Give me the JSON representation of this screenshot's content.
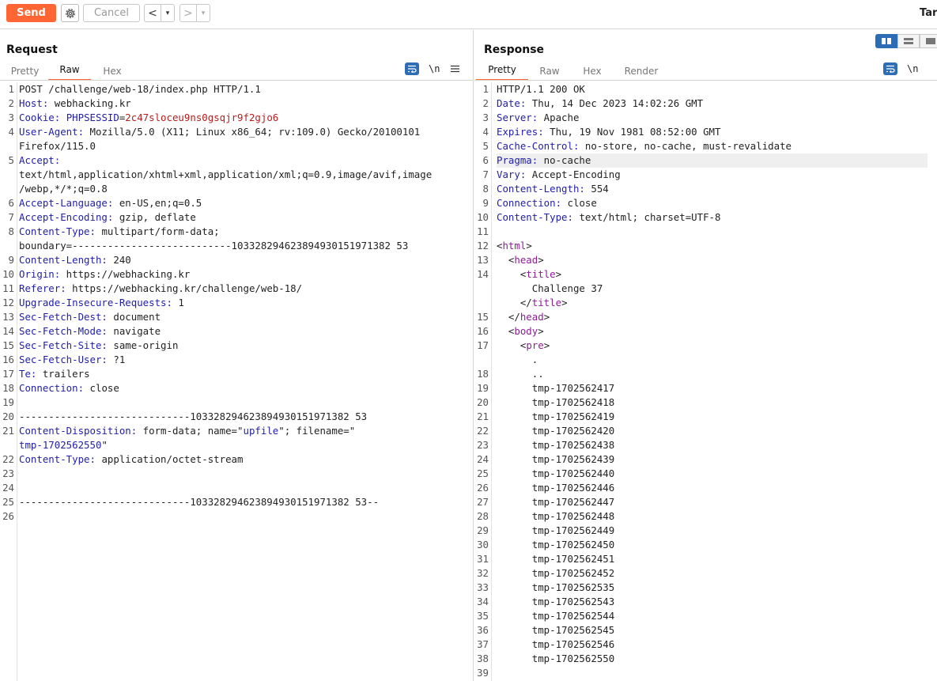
{
  "toolbar": {
    "send_label": "Send",
    "cancel_label": "Cancel",
    "back_glyph": "<",
    "forward_glyph": ">",
    "drop_glyph": "▾",
    "target_label": "Targ",
    "icons": [
      "gear-icon",
      "chevron-down-icon"
    ],
    "accent_color": "#ff6633"
  },
  "request": {
    "title": "Request",
    "tabs": [
      "Pretty",
      "Raw",
      "Hex"
    ],
    "active_tab": "Raw",
    "nl_label": "\\n",
    "lines": [
      {
        "n": "1",
        "parts": [
          {
            "t": "POST /challenge/web-18/index.php HTTP/1.1"
          }
        ]
      },
      {
        "n": "2",
        "parts": [
          {
            "t": "Host:",
            "c": "k"
          },
          {
            "t": " webhacking.kr"
          }
        ]
      },
      {
        "n": "3",
        "parts": [
          {
            "t": "Cookie:",
            "c": "k"
          },
          {
            "t": " "
          },
          {
            "t": "PHPSESSID",
            "c": "k"
          },
          {
            "t": "="
          },
          {
            "t": "2c47sloceu9ns0gsqjr9f2gjo6",
            "c": "red"
          }
        ]
      },
      {
        "n": "4",
        "parts": [
          {
            "t": "User-Agent:",
            "c": "k"
          },
          {
            "t": " Mozilla/5.0 (X11; Linux x86_64; rv:109.0) Gecko/20100101"
          }
        ]
      },
      {
        "n": "",
        "parts": [
          {
            "t": "Firefox/115.0"
          }
        ]
      },
      {
        "n": "5",
        "parts": [
          {
            "t": "Accept:",
            "c": "k"
          }
        ]
      },
      {
        "n": "",
        "parts": [
          {
            "t": "text/html,application/xhtml+xml,application/xml;q=0.9,image/avif,image"
          }
        ]
      },
      {
        "n": "",
        "parts": [
          {
            "t": "/webp,*/*;q=0.8"
          }
        ]
      },
      {
        "n": "6",
        "parts": [
          {
            "t": "Accept-Language:",
            "c": "k"
          },
          {
            "t": " en-US,en;q=0.5"
          }
        ]
      },
      {
        "n": "7",
        "parts": [
          {
            "t": "Accept-Encoding:",
            "c": "k"
          },
          {
            "t": " gzip, deflate"
          }
        ]
      },
      {
        "n": "8",
        "parts": [
          {
            "t": "Content-Type:",
            "c": "k"
          },
          {
            "t": " multipart/form-data;"
          }
        ]
      },
      {
        "n": "",
        "parts": [
          {
            "t": "boundary=---------------------------103328294623894930151971382 53"
          }
        ]
      },
      {
        "n": "9",
        "parts": [
          {
            "t": "Content-Length:",
            "c": "k"
          },
          {
            "t": " 240"
          }
        ]
      },
      {
        "n": "10",
        "parts": [
          {
            "t": "Origin:",
            "c": "k"
          },
          {
            "t": " https://webhacking.kr"
          }
        ]
      },
      {
        "n": "11",
        "parts": [
          {
            "t": "Referer:",
            "c": "k"
          },
          {
            "t": " https://webhacking.kr/challenge/web-18/"
          }
        ]
      },
      {
        "n": "12",
        "parts": [
          {
            "t": "Upgrade-Insecure-Requests:",
            "c": "k"
          },
          {
            "t": " 1"
          }
        ]
      },
      {
        "n": "13",
        "parts": [
          {
            "t": "Sec-Fetch-Dest:",
            "c": "k"
          },
          {
            "t": " document"
          }
        ]
      },
      {
        "n": "14",
        "parts": [
          {
            "t": "Sec-Fetch-Mode:",
            "c": "k"
          },
          {
            "t": " navigate"
          }
        ]
      },
      {
        "n": "15",
        "parts": [
          {
            "t": "Sec-Fetch-Site:",
            "c": "k"
          },
          {
            "t": " same-origin"
          }
        ]
      },
      {
        "n": "16",
        "parts": [
          {
            "t": "Sec-Fetch-User:",
            "c": "k"
          },
          {
            "t": " ?1"
          }
        ]
      },
      {
        "n": "17",
        "parts": [
          {
            "t": "Te:",
            "c": "k"
          },
          {
            "t": " trailers"
          }
        ]
      },
      {
        "n": "18",
        "parts": [
          {
            "t": "Connection:",
            "c": "k"
          },
          {
            "t": " close"
          }
        ]
      },
      {
        "n": "19",
        "parts": [
          {
            "t": ""
          }
        ]
      },
      {
        "n": "20",
        "parts": [
          {
            "t": "-----------------------------103328294623894930151971382 53"
          }
        ]
      },
      {
        "n": "21",
        "parts": [
          {
            "t": "Content-Disposition:",
            "c": "k"
          },
          {
            "t": " form-data; name=\""
          },
          {
            "t": "upfile",
            "c": "blue"
          },
          {
            "t": "\"; filename=\""
          }
        ]
      },
      {
        "n": "",
        "parts": [
          {
            "t": "tmp-1702562550",
            "c": "blue"
          },
          {
            "t": "\""
          }
        ]
      },
      {
        "n": "22",
        "parts": [
          {
            "t": "Content-Type:",
            "c": "k"
          },
          {
            "t": " application/octet-stream"
          }
        ]
      },
      {
        "n": "23",
        "parts": [
          {
            "t": ""
          }
        ]
      },
      {
        "n": "24",
        "parts": [
          {
            "t": ""
          }
        ]
      },
      {
        "n": "25",
        "parts": [
          {
            "t": "-----------------------------103328294623894930151971382 53--"
          }
        ]
      },
      {
        "n": "26",
        "parts": [
          {
            "t": ""
          }
        ],
        "hl": true
      }
    ]
  },
  "response": {
    "title": "Response",
    "tabs": [
      "Pretty",
      "Raw",
      "Hex",
      "Render"
    ],
    "active_tab": "Pretty",
    "nl_label": "\\n",
    "lines": [
      {
        "n": "1",
        "parts": [
          {
            "t": "HTTP/1.1 200 OK"
          }
        ]
      },
      {
        "n": "2",
        "parts": [
          {
            "t": "Date:",
            "c": "k"
          },
          {
            "t": " Thu, 14 Dec 2023 14:02:26 GMT"
          }
        ]
      },
      {
        "n": "3",
        "parts": [
          {
            "t": "Server:",
            "c": "k"
          },
          {
            "t": " Apache"
          }
        ]
      },
      {
        "n": "4",
        "parts": [
          {
            "t": "Expires:",
            "c": "k"
          },
          {
            "t": " Thu, 19 Nov 1981 08:52:00 GMT"
          }
        ]
      },
      {
        "n": "5",
        "parts": [
          {
            "t": "Cache-Control:",
            "c": "k"
          },
          {
            "t": " no-store, no-cache, must-revalidate"
          }
        ]
      },
      {
        "n": "6",
        "parts": [
          {
            "t": "Pragma:",
            "c": "k"
          },
          {
            "t": " no-cache"
          }
        ],
        "hl": true
      },
      {
        "n": "7",
        "parts": [
          {
            "t": "Vary:",
            "c": "k"
          },
          {
            "t": " Accept-Encoding"
          }
        ]
      },
      {
        "n": "8",
        "parts": [
          {
            "t": "Content-Length:",
            "c": "k"
          },
          {
            "t": " 554"
          }
        ]
      },
      {
        "n": "9",
        "parts": [
          {
            "t": "Connection:",
            "c": "k"
          },
          {
            "t": " close"
          }
        ]
      },
      {
        "n": "10",
        "parts": [
          {
            "t": "Content-Type:",
            "c": "k"
          },
          {
            "t": " text/html; charset=UTF-8"
          }
        ]
      },
      {
        "n": "11",
        "parts": [
          {
            "t": ""
          }
        ]
      },
      {
        "n": "12",
        "parts": [
          {
            "t": "<"
          },
          {
            "t": "html",
            "c": "tag"
          },
          {
            "t": ">"
          }
        ]
      },
      {
        "n": "13",
        "parts": [
          {
            "t": "  <"
          },
          {
            "t": "head",
            "c": "tag"
          },
          {
            "t": ">"
          }
        ]
      },
      {
        "n": "14",
        "parts": [
          {
            "t": "    <"
          },
          {
            "t": "title",
            "c": "tag"
          },
          {
            "t": ">"
          }
        ]
      },
      {
        "n": "",
        "parts": [
          {
            "t": "      Challenge 37"
          }
        ]
      },
      {
        "n": "",
        "parts": [
          {
            "t": "    </"
          },
          {
            "t": "title",
            "c": "tag"
          },
          {
            "t": ">"
          }
        ]
      },
      {
        "n": "15",
        "parts": [
          {
            "t": "  </"
          },
          {
            "t": "head",
            "c": "tag"
          },
          {
            "t": ">"
          }
        ]
      },
      {
        "n": "16",
        "parts": [
          {
            "t": "  <"
          },
          {
            "t": "body",
            "c": "tag"
          },
          {
            "t": ">"
          }
        ]
      },
      {
        "n": "17",
        "parts": [
          {
            "t": "    <"
          },
          {
            "t": "pre",
            "c": "tag"
          },
          {
            "t": ">"
          }
        ]
      },
      {
        "n": "",
        "parts": [
          {
            "t": "      ."
          }
        ]
      },
      {
        "n": "18",
        "parts": [
          {
            "t": "      .."
          }
        ]
      },
      {
        "n": "19",
        "parts": [
          {
            "t": "      tmp-1702562417"
          }
        ]
      },
      {
        "n": "20",
        "parts": [
          {
            "t": "      tmp-1702562418"
          }
        ]
      },
      {
        "n": "21",
        "parts": [
          {
            "t": "      tmp-1702562419"
          }
        ]
      },
      {
        "n": "22",
        "parts": [
          {
            "t": "      tmp-1702562420"
          }
        ]
      },
      {
        "n": "23",
        "parts": [
          {
            "t": "      tmp-1702562438"
          }
        ]
      },
      {
        "n": "24",
        "parts": [
          {
            "t": "      tmp-1702562439"
          }
        ]
      },
      {
        "n": "25",
        "parts": [
          {
            "t": "      tmp-1702562440"
          }
        ]
      },
      {
        "n": "26",
        "parts": [
          {
            "t": "      tmp-1702562446"
          }
        ]
      },
      {
        "n": "27",
        "parts": [
          {
            "t": "      tmp-1702562447"
          }
        ]
      },
      {
        "n": "28",
        "parts": [
          {
            "t": "      tmp-1702562448"
          }
        ]
      },
      {
        "n": "29",
        "parts": [
          {
            "t": "      tmp-1702562449"
          }
        ]
      },
      {
        "n": "30",
        "parts": [
          {
            "t": "      tmp-1702562450"
          }
        ]
      },
      {
        "n": "31",
        "parts": [
          {
            "t": "      tmp-1702562451"
          }
        ]
      },
      {
        "n": "32",
        "parts": [
          {
            "t": "      tmp-1702562452"
          }
        ]
      },
      {
        "n": "33",
        "parts": [
          {
            "t": "      tmp-1702562535"
          }
        ]
      },
      {
        "n": "34",
        "parts": [
          {
            "t": "      tmp-1702562543"
          }
        ]
      },
      {
        "n": "35",
        "parts": [
          {
            "t": "      tmp-1702562544"
          }
        ]
      },
      {
        "n": "36",
        "parts": [
          {
            "t": "      tmp-1702562545"
          }
        ]
      },
      {
        "n": "37",
        "parts": [
          {
            "t": "      tmp-1702562546"
          }
        ]
      },
      {
        "n": "38",
        "parts": [
          {
            "t": "      tmp-1702562550"
          }
        ]
      },
      {
        "n": "39",
        "parts": [
          {
            "t": ""
          }
        ]
      }
    ]
  },
  "colors": {
    "header_key": "#1f1ea8",
    "cookie_value": "#b81d1d",
    "html_tag": "#8d1c97",
    "active_blue": "#2d6db5"
  }
}
